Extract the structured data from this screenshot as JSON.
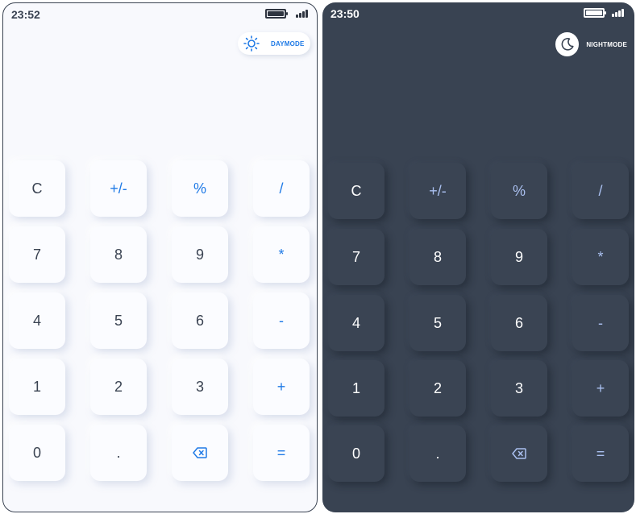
{
  "light": {
    "time": "23:52",
    "mode_label": "DAYMODE",
    "mode_icon": "sun-icon",
    "colors": {
      "background": "#f8f9fd",
      "key": "#fbfcff",
      "text": "#3a4352",
      "accent": "#1f7ae6"
    }
  },
  "dark": {
    "time": "23:50",
    "mode_label": "NIGHTMODE",
    "mode_icon": "moon-icon",
    "colors": {
      "background": "#394352",
      "key": "#3a4453",
      "text": "#ffffff",
      "accent": "#aac0f0"
    }
  },
  "keys": [
    {
      "label": "C",
      "name": "clear-key",
      "op": false
    },
    {
      "label": "+/-",
      "name": "sign-toggle-key",
      "op": true
    },
    {
      "label": "%",
      "name": "percent-key",
      "op": true
    },
    {
      "label": "/",
      "name": "divide-key",
      "op": true
    },
    {
      "label": "7",
      "name": "digit-7-key",
      "op": false
    },
    {
      "label": "8",
      "name": "digit-8-key",
      "op": false
    },
    {
      "label": "9",
      "name": "digit-9-key",
      "op": false
    },
    {
      "label": "*",
      "name": "multiply-key",
      "op": true
    },
    {
      "label": "4",
      "name": "digit-4-key",
      "op": false
    },
    {
      "label": "5",
      "name": "digit-5-key",
      "op": false
    },
    {
      "label": "6",
      "name": "digit-6-key",
      "op": false
    },
    {
      "label": "-",
      "name": "subtract-key",
      "op": true
    },
    {
      "label": "1",
      "name": "digit-1-key",
      "op": false
    },
    {
      "label": "2",
      "name": "digit-2-key",
      "op": false
    },
    {
      "label": "3",
      "name": "digit-3-key",
      "op": false
    },
    {
      "label": "+",
      "name": "add-key",
      "op": true
    },
    {
      "label": "0",
      "name": "digit-0-key",
      "op": false
    },
    {
      "label": ".",
      "name": "decimal-key",
      "op": false
    },
    {
      "label": "",
      "name": "backspace-key",
      "op": true,
      "icon": "backspace-icon"
    },
    {
      "label": "=",
      "name": "equals-key",
      "op": true
    }
  ]
}
